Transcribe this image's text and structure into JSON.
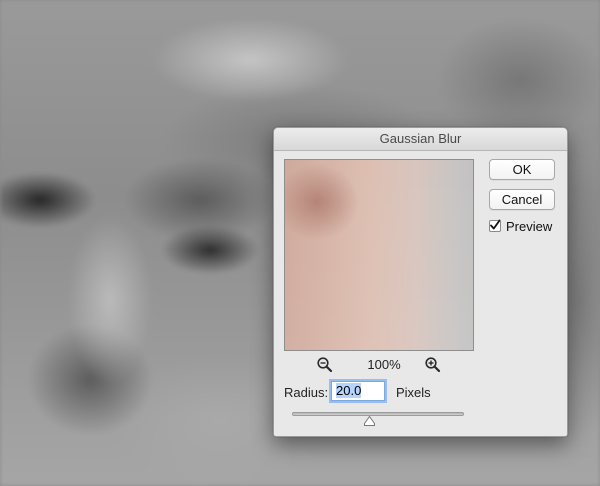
{
  "dialog": {
    "title": "Gaussian Blur",
    "zoom": {
      "level": "100%",
      "zoom_out_icon": "zoom-out-magnifier",
      "zoom_in_icon": "zoom-in-magnifier"
    },
    "radius": {
      "label": "Radius:",
      "value": "20.0",
      "unit": "Pixels",
      "slider_fraction": 0.45
    },
    "buttons": {
      "ok": "OK",
      "cancel": "Cancel"
    },
    "preview_option": {
      "label": "Preview",
      "checked": true
    }
  },
  "colors": {
    "dialog_bg": "#e8e8e8",
    "focus_ring": "#98bdf0",
    "selection": "#b5d3fb"
  }
}
